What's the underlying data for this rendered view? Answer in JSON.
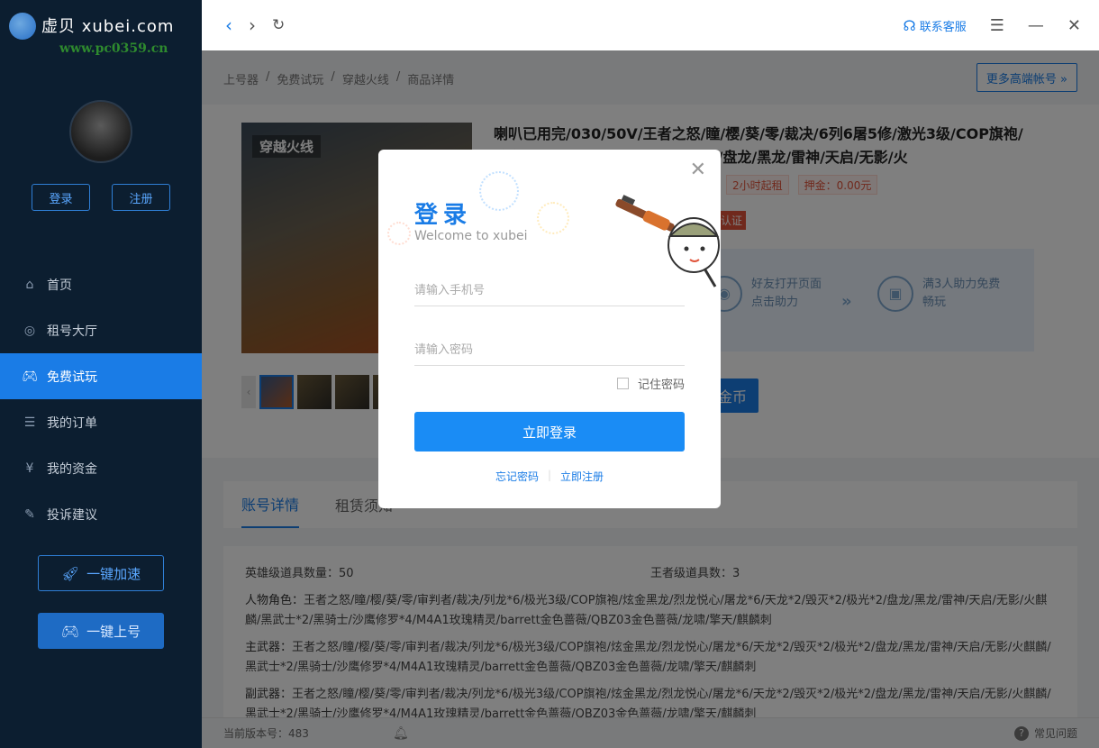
{
  "app": {
    "logo_text": "虚贝 xubei.com",
    "watermark": "www.pc0359.cn",
    "accent": "#1a7ce6"
  },
  "sidebar": {
    "login_label": "登录",
    "register_label": "注册",
    "items": [
      {
        "label": "首页",
        "icon": "home-icon"
      },
      {
        "label": "租号大厅",
        "icon": "lobby-icon"
      },
      {
        "label": "免费试玩",
        "icon": "gamepad-icon",
        "active": true
      },
      {
        "label": "我的订单",
        "icon": "order-icon"
      },
      {
        "label": "我的资金",
        "icon": "wallet-icon"
      },
      {
        "label": "投诉建议",
        "icon": "feedback-icon"
      }
    ],
    "speed_label": "一键加速",
    "quick_login_label": "一键上号"
  },
  "topbar": {
    "support_label": "联系客服"
  },
  "main": {
    "breadcrumb": [
      "上号器",
      "免费试玩",
      "穿越火线",
      "商品详情"
    ],
    "more_label": "更多高端帐号 »",
    "product": {
      "image_label": "穿越火线",
      "title": "喇叭已用完/030/50V/王者之怒/瞳/樱/葵/零/裁决/6列6屠5修/激光3级/COP旗袍/炫金黑龙/烈龙悦心/天龙*2/极光*2/盘龙/黑龙/雷神/天启/无影/火",
      "tag_rent": "2小时起租",
      "tag_deposit": "押金：0.00元",
      "cert": "认证",
      "help_step1": "好友打开页面点击助力",
      "help_step2": "满3人助力免费畅玩",
      "gold_label": "金币"
    },
    "tabs": [
      "账号详情",
      "租赁须知"
    ],
    "details": {
      "hero_label": "英雄级道具数量：50",
      "king_label": "王者级道具数：3",
      "role_label": "人物角色：",
      "role_value": "王者之怒/瞳/樱/葵/零/审判者/裁决/列龙*6/极光3级/COP旗袍/炫金黑龙/烈龙悦心/屠龙*6/天龙*2/毁灭*2/极光*2/盘龙/黑龙/雷神/天启/无影/火麒麟/黑武士*2/黑骑士/沙鹰修罗*4/M4A1玫瑰精灵/barrett金色蔷薇/QBZ03金色蔷薇/龙啸/擎天/麒麟刺",
      "primary_label": "主武器：",
      "primary_value": "王者之怒/瞳/樱/葵/零/审判者/裁决/列龙*6/极光3级/COP旗袍/炫金黑龙/烈龙悦心/屠龙*6/天龙*2/毁灭*2/极光*2/盘龙/黑龙/雷神/天启/无影/火麒麟/黑武士*2/黑骑士/沙鹰修罗*4/M4A1玫瑰精灵/barrett金色蔷薇/QBZ03金色蔷薇/龙啸/擎天/麒麟刺",
      "secondary_label": "副武器：",
      "secondary_value": "王者之怒/瞳/樱/葵/零/审判者/裁决/列龙*6/极光3级/COP旗袍/炫金黑龙/烈龙悦心/屠龙*6/天龙*2/毁灭*2/极光*2/盘龙/黑龙/雷神/天启/无影/火麒麟/黑武士*2/黑骑士/沙鹰修罗*4/M4A1玫瑰精灵/barrett金色蔷薇/QBZ03金色蔷薇/龙啸/擎天/麒麟刺"
    },
    "version": "当前版本号：483",
    "faq": "常见问题"
  },
  "modal": {
    "title": "登录",
    "subtitle": "Welcome to xubei",
    "phone_placeholder": "请输入手机号",
    "password_placeholder": "请输入密码",
    "remember_label": "记住密码",
    "login_button": "立即登录",
    "forgot_label": "忘记密码",
    "register_label": "立即注册"
  }
}
